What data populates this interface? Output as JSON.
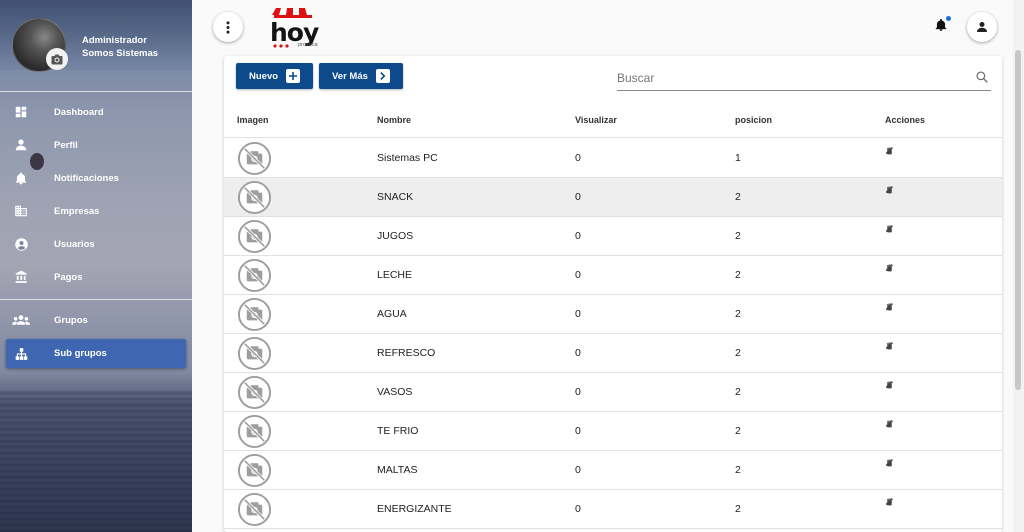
{
  "sidebar": {
    "profile": {
      "role": "Administrador",
      "company": "Somos Sistemas"
    },
    "items": [
      {
        "label": "Dashboard",
        "icon": "dashboard-icon"
      },
      {
        "label": "Perfil",
        "icon": "person-icon"
      },
      {
        "label": "Notificaciones",
        "icon": "bell-icon"
      },
      {
        "label": "Empresas",
        "icon": "building-icon"
      },
      {
        "label": "Usuarios",
        "icon": "account-circle-icon"
      },
      {
        "label": "Pagos",
        "icon": "bank-icon"
      },
      {
        "label": "Grupos",
        "icon": "group-icon"
      },
      {
        "label": "Sub grupos",
        "icon": "sitemap-icon"
      }
    ],
    "active_item": "Sub grupos"
  },
  "topbar": {
    "menu_icon": "more-vert-icon",
    "logo_text": "hoy",
    "logo_sub": "provoca",
    "notification_icon": "bell-icon",
    "account_icon": "person-icon"
  },
  "toolbar": {
    "new_label": "Nuevo",
    "more_label": "Ver Más",
    "search_placeholder": "Buscar"
  },
  "table": {
    "columns": [
      "Imagen",
      "Nombre",
      "Visualizar",
      "posicion",
      "Acciones"
    ],
    "rows": [
      {
        "nombre": "Sistemas PC",
        "visualizar": "0",
        "posicion": "1"
      },
      {
        "nombre": "SNACK",
        "visualizar": "0",
        "posicion": "2"
      },
      {
        "nombre": "JUGOS",
        "visualizar": "0",
        "posicion": "2"
      },
      {
        "nombre": "LECHE",
        "visualizar": "0",
        "posicion": "2"
      },
      {
        "nombre": "AGUA",
        "visualizar": "0",
        "posicion": "2"
      },
      {
        "nombre": "REFRESCO",
        "visualizar": "0",
        "posicion": "2"
      },
      {
        "nombre": "VASOS",
        "visualizar": "0",
        "posicion": "2"
      },
      {
        "nombre": "TE FRIO",
        "visualizar": "0",
        "posicion": "2"
      },
      {
        "nombre": "MALTAS",
        "visualizar": "0",
        "posicion": "2"
      },
      {
        "nombre": "ENERGIZANTE",
        "visualizar": "0",
        "posicion": "2"
      }
    ],
    "highlighted_row": 1
  },
  "colors": {
    "primary_button": "#0c4a8c",
    "active_nav": "#3f66b0",
    "notification_dot": "#1e6fd9"
  }
}
